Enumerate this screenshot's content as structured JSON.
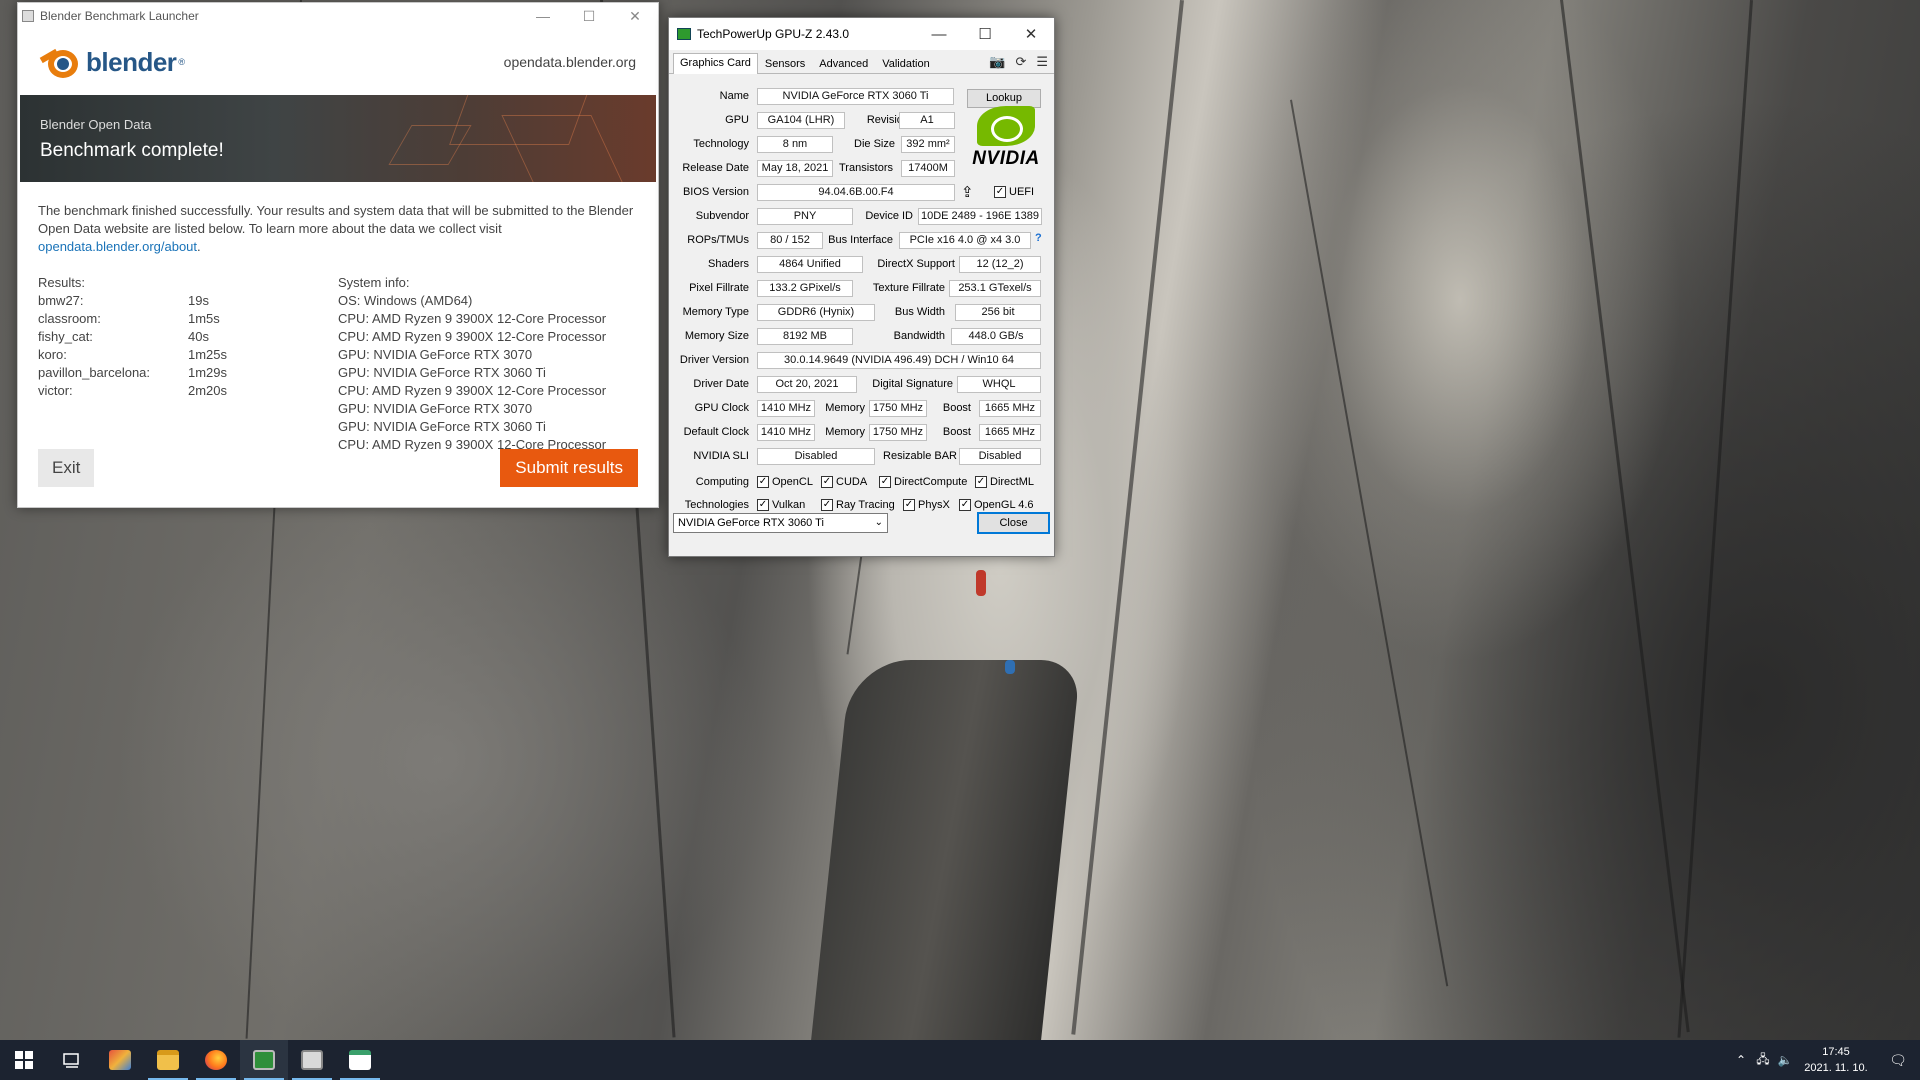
{
  "blender": {
    "window_title": "Blender Benchmark Launcher",
    "logo_text": "blender",
    "site": "opendata.blender.org",
    "banner_subtitle": "Blender Open Data",
    "banner_title": "Benchmark complete!",
    "description": "The benchmark finished successfully. Your results and system data that will be submitted to the Blender Open Data website are listed below. To learn more about the data we collect visit ",
    "link": "opendata.blender.org/about",
    "link_suffix": ".",
    "results_header": "Results:",
    "sysinfo_header": "System info:",
    "results": [
      {
        "name": "bmw27:",
        "time": "19s"
      },
      {
        "name": "classroom:",
        "time": "1m5s"
      },
      {
        "name": "fishy_cat:",
        "time": "40s"
      },
      {
        "name": "koro:",
        "time": "1m25s"
      },
      {
        "name": "pavillon_barcelona:",
        "time": "1m29s"
      },
      {
        "name": "victor:",
        "time": "2m20s"
      }
    ],
    "sysinfo": [
      "OS: Windows (AMD64)",
      "CPU: AMD Ryzen 9 3900X 12-Core Processor",
      "CPU: AMD Ryzen 9 3900X 12-Core Processor",
      "GPU: NVIDIA GeForce RTX 3070",
      "GPU: NVIDIA GeForce RTX 3060 Ti",
      "CPU: AMD Ryzen 9 3900X 12-Core Processor",
      "GPU: NVIDIA GeForce RTX 3070",
      "GPU: NVIDIA GeForce RTX 3060 Ti",
      "CPU: AMD Ryzen 9 3900X 12-Core Processor"
    ],
    "exit_label": "Exit",
    "submit_label": "Submit results"
  },
  "gpuz": {
    "window_title": "TechPowerUp GPU-Z 2.43.0",
    "tabs": [
      "Graphics Card",
      "Sensors",
      "Advanced",
      "Validation"
    ],
    "lookup_label": "Lookup",
    "vendor_logo_text": "NVIDIA",
    "labels": {
      "name": "Name",
      "gpu": "GPU",
      "revision": "Revision",
      "technology": "Technology",
      "die_size": "Die Size",
      "release_date": "Release Date",
      "transistors": "Transistors",
      "bios_version": "BIOS Version",
      "uefi": "UEFI",
      "subvendor": "Subvendor",
      "device_id": "Device ID",
      "rops_tmus": "ROPs/TMUs",
      "bus_interface": "Bus Interface",
      "shaders": "Shaders",
      "directx_support": "DirectX Support",
      "pixel_fillrate": "Pixel Fillrate",
      "texture_fillrate": "Texture Fillrate",
      "memory_type": "Memory Type",
      "bus_width": "Bus Width",
      "memory_size": "Memory Size",
      "bandwidth": "Bandwidth",
      "driver_version": "Driver Version",
      "driver_date": "Driver Date",
      "digital_signature": "Digital Signature",
      "gpu_clock": "GPU Clock",
      "memory": "Memory",
      "boost": "Boost",
      "default_clock": "Default Clock",
      "nvidia_sli": "NVIDIA SLI",
      "resizable_bar": "Resizable BAR",
      "computing": "Computing",
      "technologies": "Technologies",
      "help": "?"
    },
    "values": {
      "name": "NVIDIA GeForce RTX 3060 Ti",
      "gpu": "GA104 (LHR)",
      "revision": "A1",
      "technology": "8 nm",
      "die_size": "392 mm²",
      "release_date": "May 18, 2021",
      "transistors": "17400M",
      "bios_version": "94.04.6B.00.F4",
      "subvendor": "PNY",
      "device_id": "10DE 2489 - 196E 1389",
      "rops_tmus": "80 / 152",
      "bus_interface": "PCIe x16 4.0 @ x4 3.0",
      "shaders": "4864 Unified",
      "directx_support": "12 (12_2)",
      "pixel_fillrate": "133.2 GPixel/s",
      "texture_fillrate": "253.1 GTexel/s",
      "memory_type": "GDDR6 (Hynix)",
      "bus_width": "256 bit",
      "memory_size": "8192 MB",
      "bandwidth": "448.0 GB/s",
      "driver_version": "30.0.14.9649 (NVIDIA 496.49) DCH / Win10 64",
      "driver_date": "Oct 20, 2021",
      "digital_signature": "WHQL",
      "gpu_clock": "1410 MHz",
      "gpu_memory": "1750 MHz",
      "gpu_boost": "1665 MHz",
      "default_clock": "1410 MHz",
      "default_memory": "1750 MHz",
      "default_boost": "1665 MHz",
      "nvidia_sli": "Disabled",
      "resizable_bar": "Disabled"
    },
    "computing": [
      "OpenCL",
      "CUDA",
      "DirectCompute",
      "DirectML"
    ],
    "technologies": [
      "Vulkan",
      "Ray Tracing",
      "PhysX",
      "OpenGL 4.6"
    ],
    "gpu_select": "NVIDIA GeForce RTX 3060 Ti",
    "close_label": "Close"
  },
  "taskbar": {
    "apps": [
      "start-icon",
      "task-view-icon",
      "paint-3d-icon",
      "file-explorer-icon",
      "firefox-icon",
      "gpuz-icon",
      "blender-benchmark-icon",
      "window-app-icon"
    ],
    "time": "17:45",
    "date": "2021. 11. 10."
  }
}
